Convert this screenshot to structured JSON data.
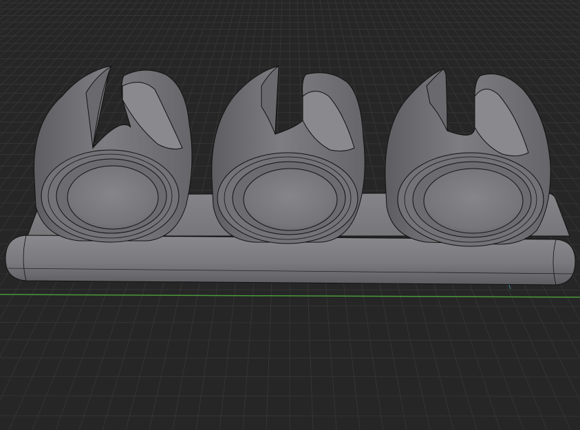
{
  "viewport": {
    "background": "#262626",
    "grid_line_color": "#3a3a3a",
    "x_axis_color": "#4a9a3a",
    "y_axis_color": "#4aa8c8"
  },
  "model": {
    "clip_count": 3,
    "surface_color": "#7b7b7e",
    "edge_color": "#101010"
  }
}
